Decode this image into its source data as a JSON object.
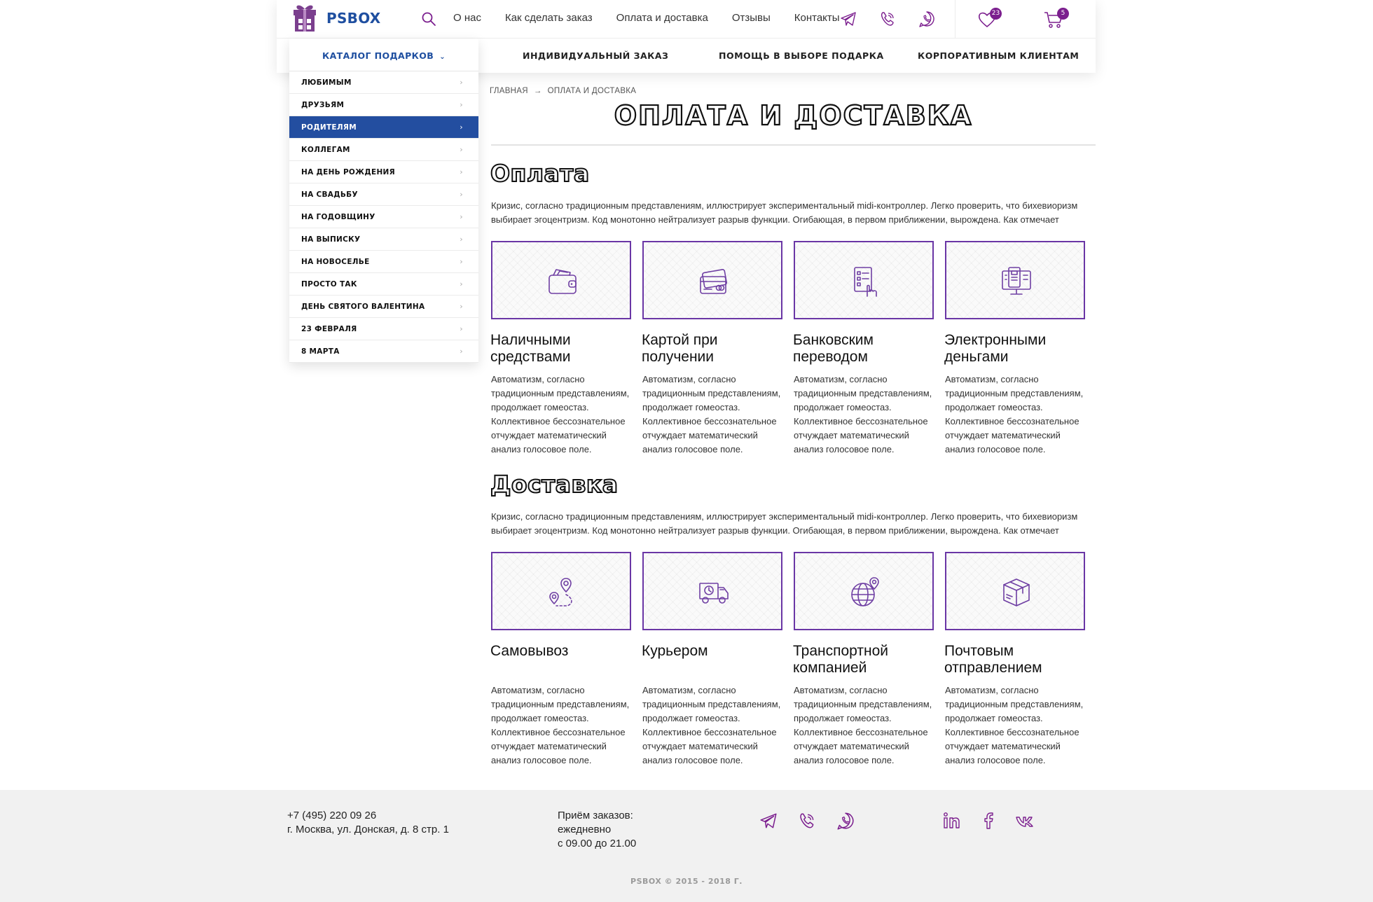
{
  "header": {
    "logo_text": "PSBOX",
    "nav": [
      "О нас",
      "Как сделать заказ",
      "Оплата и доставка",
      "Отзывы",
      "Контакты"
    ],
    "favorites_count": "23",
    "cart_count": "5",
    "secondary_nav": [
      "ИНДИВИДУАЛЬНЫЙ ЗАКАЗ",
      "ПОМОЩЬ В ВЫБОРЕ ПОДАРКА",
      "КОРПОРАТИВНЫМ КЛИЕНТАМ"
    ]
  },
  "catalog": {
    "title": "КАТАЛОГ ПОДАРКОВ",
    "items": [
      "ЛЮБИМЫМ",
      "ДРУЗЬЯМ",
      "РОДИТЕЛЯМ",
      "КОЛЛЕГАМ",
      "НА ДЕНЬ РОЖДЕНИЯ",
      "НА СВАДЬБУ",
      "НА ГОДОВЩИНУ",
      "НА ВЫПИСКУ",
      "НА НОВОСЕЛЬЕ",
      "ПРОСТО ТАК",
      "ДЕНЬ СВЯТОГО ВАЛЕНТИНА",
      "23 ФЕВРАЛЯ",
      "8 МАРТА"
    ],
    "active_item": "РОДИТЕЛЯМ"
  },
  "breadcrumb": {
    "home": "ГЛАВНАЯ",
    "separator": "→",
    "current": "ОПЛАТА И ДОСТАВКА"
  },
  "page_title": "ОПЛАТА И ДОСТАВКА",
  "payment": {
    "title": "Оплата",
    "text": "Кризис, согласно традиционным представлениям, иллюстрирует экспериментальный midi-контроллер. Легко проверить, что бихевиоризм выбирает эгоцентризм. Код монотонно нейтрализует разрыв функции. Огибающая, в первом приближении, вырождена. Как отмечает",
    "cards": [
      {
        "icon": "wallet-icon",
        "title": "Наличными средствами",
        "text": "Автоматизм, согласно традиционным представлениям, продолжает гомеостаз. Коллективное бессознательное отчуждает математический анализ голосовое поле."
      },
      {
        "icon": "credit-card-icon",
        "title": "Картой при получении",
        "text": "Автоматизм, согласно традиционным представлениям, продолжает гомеостаз. Коллективное бессознательное отчуждает математический анализ голосовое поле."
      },
      {
        "icon": "bank-transfer-icon",
        "title": "Банковским переводом",
        "text": "Автоматизм, согласно традиционным представлениям, продолжает гомеостаз. Коллективное бессознательное отчуждает математический анализ голосовое поле."
      },
      {
        "icon": "electronic-money-icon",
        "title": "Электронными деньгами",
        "text": "Автоматизм, согласно традиционным представлениям, продолжает гомеостаз. Коллективное бессознательное отчуждает математический анализ голосовое поле."
      }
    ]
  },
  "delivery": {
    "title": "Доставка",
    "text": "Кризис, согласно традиционным представлениям, иллюстрирует экспериментальный midi-контроллер. Легко проверить, что бихевиоризм выбирает эгоцентризм. Код монотонно нейтрализует разрыв функции. Огибающая, в первом приближении, вырождена. Как отмечает",
    "cards": [
      {
        "icon": "pickup-route-icon",
        "title": "Самовывоз",
        "text": "Автоматизм, согласно традиционным представлениям, продолжает гомеостаз. Коллективное бессознательное отчуждает математический анализ голосовое поле."
      },
      {
        "icon": "courier-truck-icon",
        "title": "Курьером",
        "text": "Автоматизм, согласно традиционным представлениям, продолжает гомеостаз. Коллективное бессознательное отчуждает математический анализ голосовое поле."
      },
      {
        "icon": "globe-pin-icon",
        "title": "Транспортной компанией",
        "text": "Автоматизм, согласно традиционным представлениям, продолжает гомеостаз. Коллективное бессознательное отчуждает математический анализ голосовое поле."
      },
      {
        "icon": "parcel-box-icon",
        "title": "Почтовым отправлением",
        "text": "Автоматизм, согласно традиционным представлениям, продолжает гомеостаз. Коллективное бессознательное отчуждает математический анализ голосовое поле."
      }
    ]
  },
  "footer": {
    "phone": "+7 (495) 220 09 26",
    "address": "г. Москва, ул. Донская, д. 8 стр. 1",
    "hours_label": "Приём заказов:",
    "hours_days": "ежедневно",
    "hours_time": "с 09.00 до 21.00",
    "copyright": "PSBOX © 2015 - 2018 Г."
  },
  "colors": {
    "brand_blue": "#1f4fa0",
    "accent_purple": "#7b1e8e",
    "active_item_bg": "#234ea0"
  }
}
